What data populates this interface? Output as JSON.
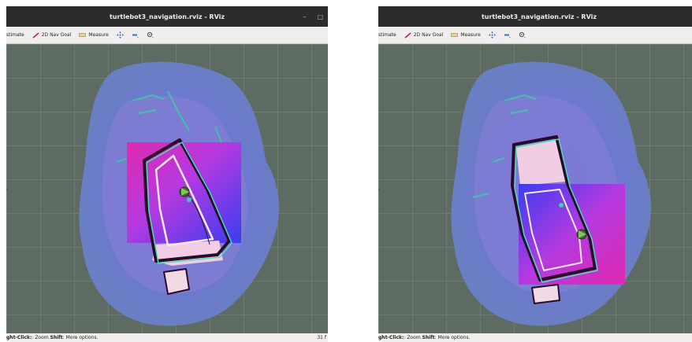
{
  "windows": [
    {
      "title": "turtlebot3_navigation.rviz - RViz",
      "controls": {
        "minimize": "–",
        "maximize": "□"
      },
      "toolbar": {
        "estimate": "stimate",
        "nav_goal": "2D Nav Goal",
        "measure": "Measure"
      },
      "status": {
        "prefix": "ght-Click:",
        "zoom": ": Zoom. ",
        "shift": "Shift",
        "more": ": More options."
      },
      "fps": "31 f"
    },
    {
      "title": "turtlebot3_navigation.rviz - RViz",
      "controls": {
        "minimize": "–"
      },
      "toolbar": {
        "estimate": "stimate",
        "nav_goal": "2D Nav Goal",
        "measure": "Measure"
      },
      "status": {
        "prefix": "ght-Click:",
        "zoom": ": Zoom. ",
        "shift": "Shift",
        "more": ": More options."
      },
      "fps": ""
    }
  ],
  "colors": {
    "grid_bg": "#5d6b63",
    "titlebar": "#2c2c2c",
    "nav_goal": "#c2185b",
    "tool_blue": "#2f6fdc"
  },
  "icons": {
    "nav_goal": "nav-goal-arrow-icon",
    "measure": "ruler-icon",
    "move": "move-camera-icon",
    "select": "select-icon",
    "focus": "focus-camera-icon"
  }
}
